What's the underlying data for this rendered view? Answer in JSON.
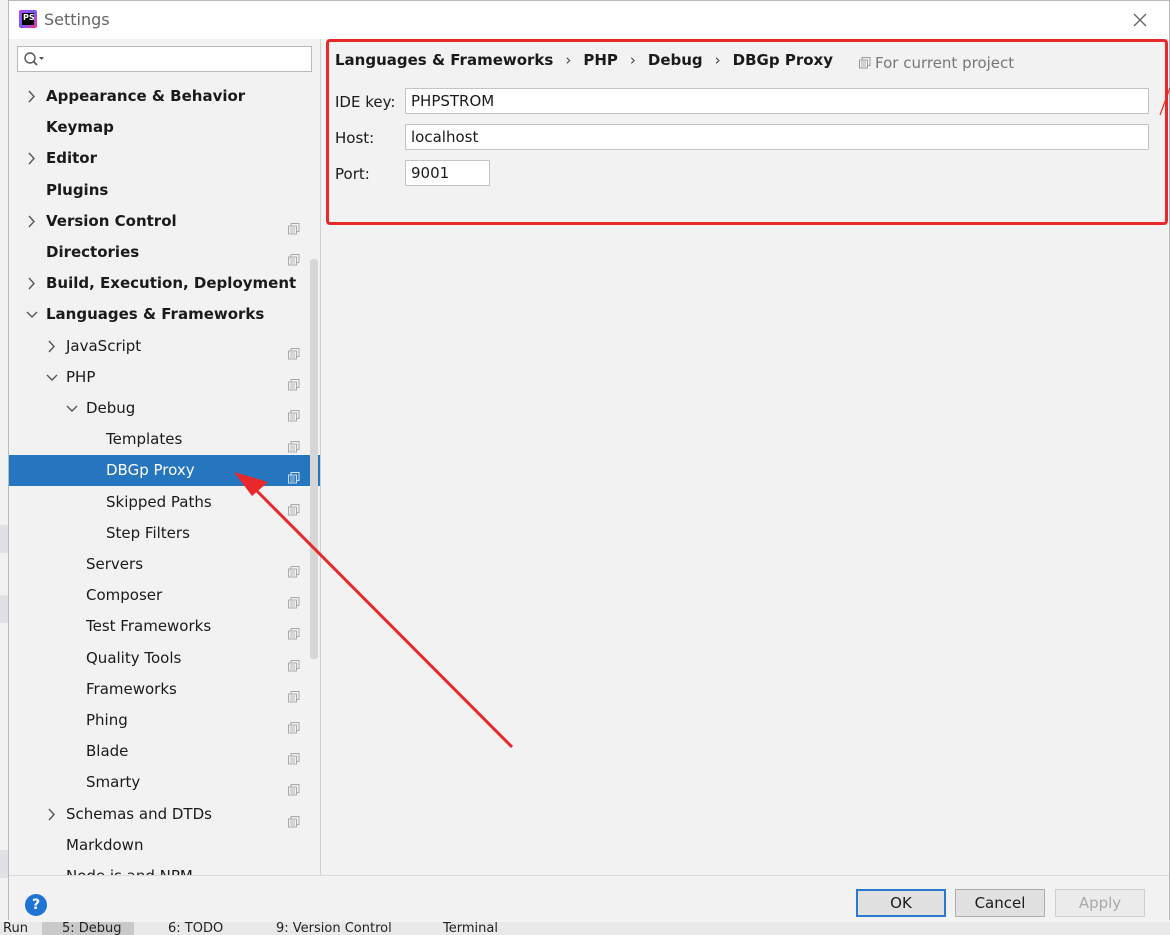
{
  "window": {
    "title": "Settings"
  },
  "search": {
    "placeholder": ""
  },
  "tree": [
    {
      "label": "Appearance & Behavior",
      "level": 0,
      "bold": true,
      "arrow": "right",
      "proj": false
    },
    {
      "label": "Keymap",
      "level": 0,
      "bold": true,
      "arrow": "none",
      "proj": false
    },
    {
      "label": "Editor",
      "level": 0,
      "bold": true,
      "arrow": "right",
      "proj": false
    },
    {
      "label": "Plugins",
      "level": 0,
      "bold": true,
      "arrow": "none",
      "proj": false
    },
    {
      "label": "Version Control",
      "level": 0,
      "bold": true,
      "arrow": "right",
      "proj": true
    },
    {
      "label": "Directories",
      "level": 0,
      "bold": true,
      "arrow": "none",
      "proj": true
    },
    {
      "label": "Build, Execution, Deployment",
      "level": 0,
      "bold": true,
      "arrow": "right",
      "proj": false
    },
    {
      "label": "Languages & Frameworks",
      "level": 0,
      "bold": true,
      "arrow": "down",
      "proj": false
    },
    {
      "label": "JavaScript",
      "level": 1,
      "bold": false,
      "arrow": "right",
      "proj": true
    },
    {
      "label": "PHP",
      "level": 1,
      "bold": false,
      "arrow": "down",
      "proj": true
    },
    {
      "label": "Debug",
      "level": 2,
      "bold": false,
      "arrow": "down",
      "proj": true
    },
    {
      "label": "Templates",
      "level": 3,
      "bold": false,
      "arrow": "none",
      "proj": true
    },
    {
      "label": "DBGp Proxy",
      "level": 3,
      "bold": false,
      "arrow": "none",
      "proj": true,
      "selected": true
    },
    {
      "label": "Skipped Paths",
      "level": 3,
      "bold": false,
      "arrow": "none",
      "proj": true
    },
    {
      "label": "Step Filters",
      "level": 3,
      "bold": false,
      "arrow": "none",
      "proj": false
    },
    {
      "label": "Servers",
      "level": 2,
      "bold": false,
      "arrow": "none",
      "proj": true
    },
    {
      "label": "Composer",
      "level": 2,
      "bold": false,
      "arrow": "none",
      "proj": true
    },
    {
      "label": "Test Frameworks",
      "level": 2,
      "bold": false,
      "arrow": "none",
      "proj": true
    },
    {
      "label": "Quality Tools",
      "level": 2,
      "bold": false,
      "arrow": "none",
      "proj": true
    },
    {
      "label": "Frameworks",
      "level": 2,
      "bold": false,
      "arrow": "none",
      "proj": true
    },
    {
      "label": "Phing",
      "level": 2,
      "bold": false,
      "arrow": "none",
      "proj": true
    },
    {
      "label": "Blade",
      "level": 2,
      "bold": false,
      "arrow": "none",
      "proj": true
    },
    {
      "label": "Smarty",
      "level": 2,
      "bold": false,
      "arrow": "none",
      "proj": true
    },
    {
      "label": "Schemas and DTDs",
      "level": 1,
      "bold": false,
      "arrow": "right",
      "proj": true
    },
    {
      "label": "Markdown",
      "level": 1,
      "bold": false,
      "arrow": "none",
      "proj": false
    },
    {
      "label": "Node.js and NPM",
      "level": 1,
      "bold": false,
      "arrow": "none",
      "proj": true
    }
  ],
  "breadcrumb": [
    "Languages & Frameworks",
    "PHP",
    "Debug",
    "DBGp Proxy"
  ],
  "breadcrumb_sep": "›",
  "for_project": "For current project",
  "form": {
    "ide_key": {
      "label": "IDE key:",
      "value": "PHPSTROM"
    },
    "host": {
      "label": "Host:",
      "value": "localhost"
    },
    "port": {
      "label": "Port:",
      "value": "9001"
    }
  },
  "buttons": {
    "help": "?",
    "ok": "OK",
    "cancel": "Cancel",
    "apply": "Apply"
  },
  "bottom_tabs": [
    "Run",
    "5: Debug",
    "6: TODO",
    "9: Version Control",
    "Terminal"
  ],
  "colors": {
    "selection": "#2675bf",
    "highlight": "#e8282a",
    "accent": "#2b78cf"
  }
}
